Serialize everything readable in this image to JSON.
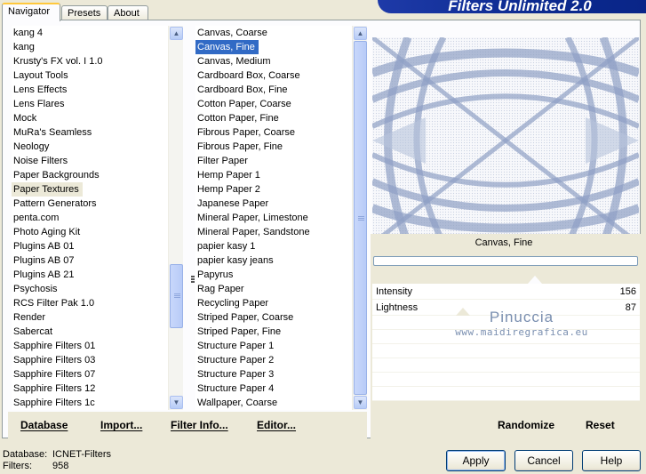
{
  "window": {
    "banner_title": "Filters Unlimited 2.0"
  },
  "tabs": [
    {
      "label": "Navigator",
      "active": true
    },
    {
      "label": "Presets",
      "active": false
    },
    {
      "label": "About",
      "active": false
    }
  ],
  "categories": {
    "items": [
      "kang 4",
      "kang",
      "Krusty's FX vol. I 1.0",
      "Layout Tools",
      "Lens Effects",
      "Lens Flares",
      "Mock",
      "MuRa's Seamless",
      "Neology",
      "Noise Filters",
      "Paper Backgrounds",
      "Paper Textures",
      "Pattern Generators",
      "penta.com",
      "Photo Aging Kit",
      "Plugins AB 01",
      "Plugins AB 07",
      "Plugins AB 21",
      "Psychosis",
      "RCS Filter Pak 1.0",
      "Render",
      "Sabercat",
      "Sapphire Filters 01",
      "Sapphire Filters 03",
      "Sapphire Filters 07",
      "Sapphire Filters 12",
      "Sapphire Filters 1c"
    ],
    "selected": "Paper Textures"
  },
  "filters": {
    "items": [
      "Canvas, Coarse",
      "Canvas, Fine",
      "Canvas, Medium",
      "Cardboard Box, Coarse",
      "Cardboard Box, Fine",
      "Cotton Paper, Coarse",
      "Cotton Paper, Fine",
      "Fibrous Paper, Coarse",
      "Fibrous Paper, Fine",
      "Filter Paper",
      "Hemp Paper 1",
      "Hemp Paper 2",
      "Japanese Paper",
      "Mineral Paper, Limestone",
      "Mineral Paper, Sandstone",
      "papier kasy 1",
      "papier kasy jeans",
      "Papyrus",
      "Rag Paper",
      "Recycling Paper",
      "Striped Paper, Coarse",
      "Striped Paper, Fine",
      "Structure Paper 1",
      "Structure Paper 2",
      "Structure Paper 3",
      "Structure Paper 4",
      "Wallpaper, Coarse"
    ],
    "selected": "Canvas, Fine"
  },
  "toolbar": {
    "database": "Database",
    "import": "Import...",
    "filter_info": "Filter Info...",
    "editor": "Editor...",
    "randomize": "Randomize",
    "reset": "Reset"
  },
  "preview": {
    "filter_name": "Canvas, Fine"
  },
  "params": [
    {
      "label": "Intensity",
      "value": "156",
      "level": 0.61
    },
    {
      "label": "Lightness",
      "value": "87",
      "level": 0.34
    }
  ],
  "watermark": {
    "title": "Pinuccia",
    "url": "www.maidiregrafica.eu"
  },
  "status": {
    "database_label": "Database:",
    "database_value": "ICNET-Filters",
    "filters_label": "Filters:",
    "filters_value": "958"
  },
  "buttons": {
    "apply": "Apply",
    "cancel": "Cancel",
    "help": "Help"
  },
  "colors": {
    "selection": "#316ac5",
    "banner": "#0b2a8f",
    "face": "#ece9d8"
  }
}
